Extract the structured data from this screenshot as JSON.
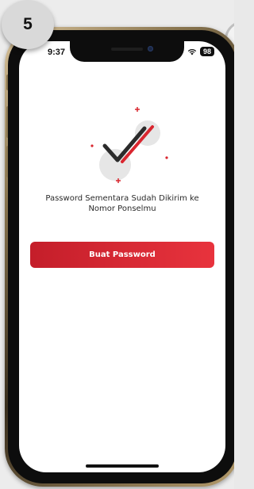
{
  "step": {
    "number": "5"
  },
  "status_bar": {
    "time": "9:37",
    "battery": "98"
  },
  "screen": {
    "message": "Password Sementara Sudah Dikirim ke Nomor Ponselmu",
    "primary_button_label": "Buat Password"
  },
  "colors": {
    "accent": "#d9262f",
    "check_dark": "#2b2b2b",
    "bubble": "#e6e6e6"
  },
  "icons": {
    "illustration": "checkmark-icon",
    "wifi": "wifi-icon",
    "battery": "battery-icon"
  }
}
